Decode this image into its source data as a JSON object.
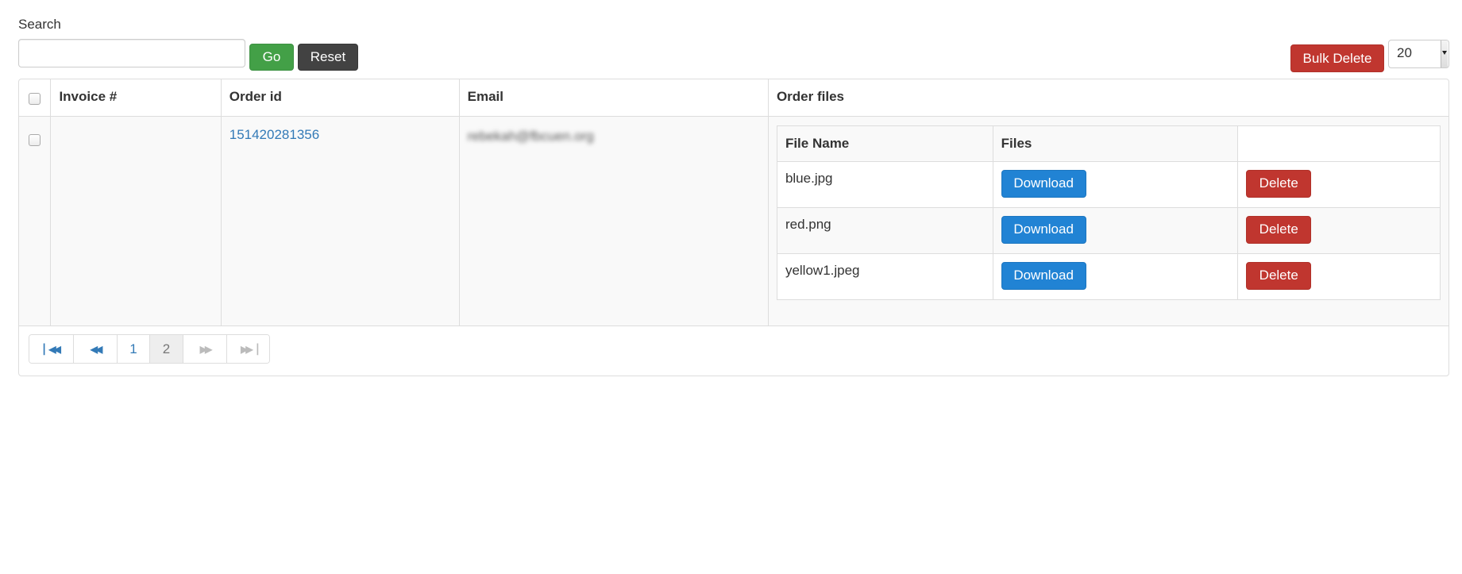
{
  "search": {
    "label": "Search",
    "value": "",
    "placeholder": "",
    "go_label": "Go",
    "reset_label": "Reset"
  },
  "toolbar": {
    "bulk_delete_label": "Bulk Delete",
    "page_size": "20"
  },
  "colors": {
    "go": "#43a047",
    "reset": "#424242",
    "danger": "#c0362f",
    "primary": "#2183d4",
    "link": "#337ab7"
  },
  "table": {
    "headers": {
      "select_all": "",
      "invoice": "Invoice #",
      "order_id": "Order id",
      "email": "Email",
      "order_files": "Order files"
    },
    "rows": [
      {
        "invoice": "",
        "order_id": "151420281356",
        "email": "rebekah@fbcuen.org",
        "files": {
          "headers": {
            "file_name": "File Name",
            "files": "Files",
            "actions": ""
          },
          "items": [
            {
              "file_name": "blue.jpg",
              "download_label": "Download",
              "delete_label": "Delete"
            },
            {
              "file_name": "red.png",
              "download_label": "Download",
              "delete_label": "Delete"
            },
            {
              "file_name": "yellow1.jpeg",
              "download_label": "Download",
              "delete_label": "Delete"
            }
          ]
        }
      }
    ]
  },
  "pagination": {
    "first_icon": "first-page-icon",
    "prev_icon": "previous-page-icon",
    "pages": [
      "1",
      "2"
    ],
    "current_page": "2",
    "next_icon": "next-page-icon",
    "last_icon": "last-page-icon"
  }
}
